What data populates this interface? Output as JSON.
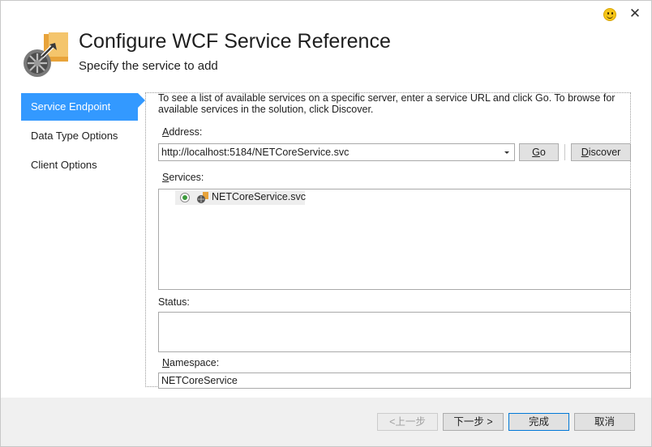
{
  "window": {
    "feedback_icon": "smiley-icon",
    "close_glyph": "✕"
  },
  "header": {
    "title": "Configure WCF Service Reference",
    "subtitle": "Specify the service to add",
    "logo_icon": "wcf-service-reference-icon"
  },
  "nav": {
    "items": [
      {
        "label": "Service Endpoint",
        "active": true
      },
      {
        "label": "Data Type Options",
        "active": false
      },
      {
        "label": "Client Options",
        "active": false
      }
    ]
  },
  "main": {
    "info_text": "To see a list of available services on a specific server, enter a service URL and click Go. To browse for available services in the solution, click Discover.",
    "address": {
      "label_key": "A",
      "label_rest": "ddress:",
      "value": "http://localhost:5184/NETCoreService.svc"
    },
    "go_button": {
      "key": "G",
      "rest": "o"
    },
    "discover_button": {
      "key": "D",
      "rest": "iscover"
    },
    "services": {
      "label_key": "S",
      "label_rest": "ervices:",
      "items": [
        {
          "label": "NETCoreService.svc",
          "selected": true
        }
      ]
    },
    "status": {
      "label": "Status:",
      "value": ""
    },
    "namespace": {
      "label_key": "N",
      "label_rest": "amespace:",
      "value": "NETCoreService"
    }
  },
  "footer": {
    "prev_label": "<上一步",
    "next_label": "下一步 >",
    "finish_label": "完成",
    "cancel_label": "取消"
  },
  "colors": {
    "accent": "#3399ff",
    "footer_bg": "#f0f0f0",
    "primary_border": "#0078d7"
  }
}
